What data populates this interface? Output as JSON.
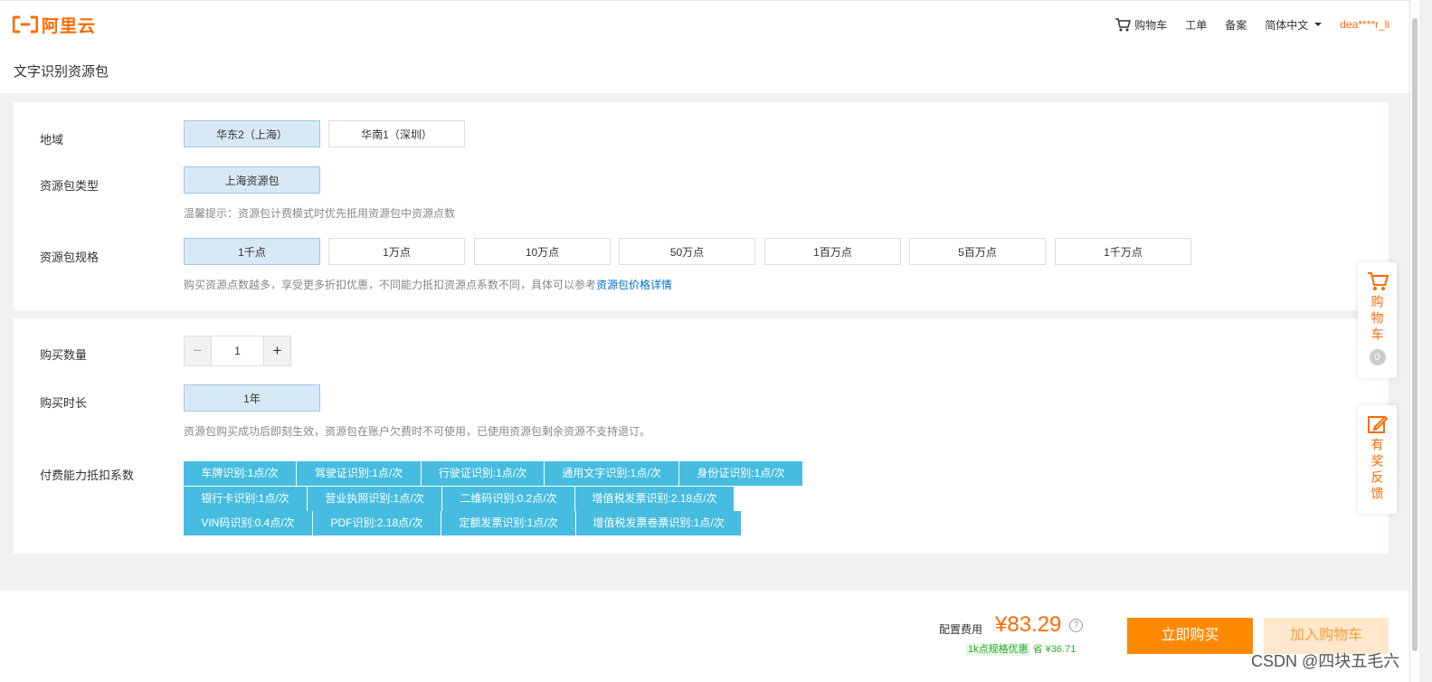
{
  "header": {
    "logo_text": "阿里云",
    "nav": {
      "cart": "购物车",
      "ticket": "工单",
      "beian": "备案",
      "lang": "简体中文",
      "user": "dea****r_li"
    }
  },
  "page": {
    "title": "文字识别资源包"
  },
  "config": {
    "region": {
      "label": "地域",
      "options": [
        "华东2（上海）",
        "华南1（深圳）"
      ],
      "selected": "华东2（上海）"
    },
    "package_type": {
      "label": "资源包类型",
      "options": [
        "上海资源包"
      ],
      "hint": "温馨提示：资源包计费模式时优先抵用资源包中资源点数"
    },
    "spec": {
      "label": "资源包规格",
      "options": [
        "1千点",
        "1万点",
        "10万点",
        "50万点",
        "1百万点",
        "5百万点",
        "1千万点"
      ],
      "selected": "1千点",
      "hint": "购买资源点数越多，享受更多折扣优惠，不同能力抵扣资源点系数不同，具体可以参考",
      "hint_link": "资源包价格详情"
    }
  },
  "purchase": {
    "quantity": {
      "label": "购买数量",
      "value": "1"
    },
    "duration": {
      "label": "购买时长",
      "options": [
        "1年"
      ],
      "hint": "资源包购买成功后即刻生效，资源包在账户欠费时不可使用，已使用资源包剩余资源不支持退订。"
    },
    "coef": {
      "label": "付费能力抵扣系数",
      "rows": [
        [
          "车牌识别:1点/次",
          "驾驶证识别:1点/次",
          "行驶证识别:1点/次",
          "通用文字识别:1点/次",
          "身份证识别:1点/次"
        ],
        [
          "银行卡识别:1点/次",
          "营业执照识别:1点/次",
          "二维码识别:0.2点/次",
          "增值税发票识别:2.18点/次"
        ],
        [
          "VIN码识别:0.4点/次",
          "PDF识别:2.18点/次",
          "定额发票识别:1点/次",
          "增值税发票卷票识别:1点/次"
        ]
      ]
    }
  },
  "footer": {
    "cost_label": "配置费用",
    "price": "¥83.29",
    "discount_badge": "1k点规格优惠",
    "discount_save": "省 ¥36.71",
    "buy": "立即购买",
    "add_cart": "加入购物车"
  },
  "side": {
    "cart": "购物车",
    "cart_count": "0",
    "feedback": "有奖反馈"
  },
  "watermark": "CSDN @四块五毛六",
  "colors": {
    "accent": "#ff6a00",
    "tag": "#46bde0",
    "selected": "#d8e9f6"
  }
}
